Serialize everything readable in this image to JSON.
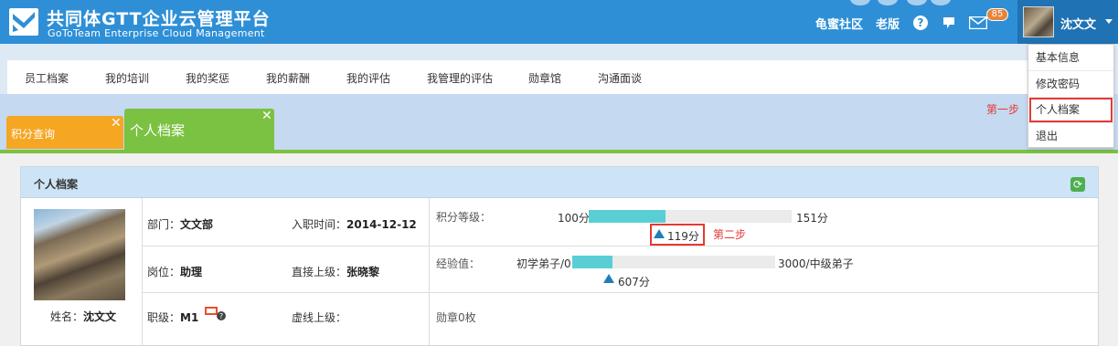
{
  "header": {
    "title": "共同体GTT企业云管理平台",
    "subtitle": "GoToTeam Enterprise Cloud Management",
    "links": [
      "龟蜜社区",
      "老版"
    ],
    "mail_count": "85",
    "user_name": "沈文文"
  },
  "dropdown": {
    "items": [
      "基本信息",
      "修改密码",
      "个人档案",
      "退出"
    ],
    "selected": "个人档案"
  },
  "nav": {
    "items": [
      "员工档案",
      "我的培训",
      "我的奖惩",
      "我的薪酬",
      "我的评估",
      "我管理的评估",
      "勋章馆",
      "沟通面谈"
    ]
  },
  "tabs": [
    {
      "label": "积分查询",
      "color": "#f5a623",
      "active": false
    },
    {
      "label": "个人档案",
      "color": "#7bc142",
      "active": true
    }
  ],
  "annotations": {
    "step1": "第一步",
    "step2": "第二步"
  },
  "profile": {
    "panel_title": "个人档案",
    "name_label": "姓名：",
    "name": "沈文文",
    "department_label": "部门：",
    "department": "文文部",
    "hire_date_label": "入职时间：",
    "hire_date": "2014-12-12",
    "position_label": "岗位：",
    "position": "助理",
    "supervisor_label": "直接上级：",
    "supervisor": "张晓黎",
    "rank_label": "职级：",
    "rank": "M1",
    "virtual_supervisor_label": "虚线上级：",
    "virtual_supervisor": ""
  },
  "points": {
    "label": "积分等级：",
    "min_label": "100分",
    "max_label": "151分",
    "current_label": "119分",
    "progress": 0.38
  },
  "experience": {
    "label": "经验值：",
    "min_label": "初学弟子/0",
    "max_label": "3000/中级弟子",
    "current_label": "607分",
    "progress": 0.2
  },
  "medals": {
    "text": "勋章0枚"
  },
  "colors": {
    "header": "#2e8fd6",
    "accent_green": "#7bc142",
    "accent_orange": "#f5a623",
    "bar_fill": "#59cfd5",
    "marker": "#1e7fb5",
    "highlight_red": "#e53935"
  }
}
